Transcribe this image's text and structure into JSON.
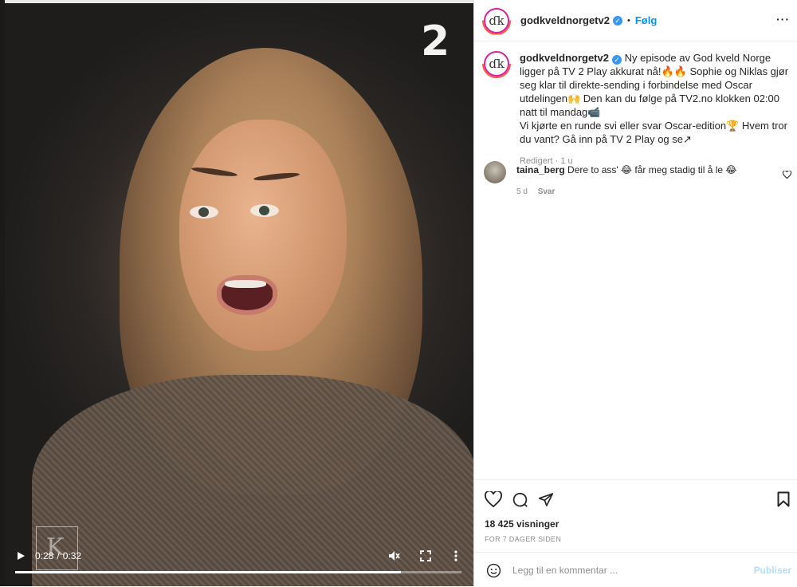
{
  "video": {
    "channel_logo": "2",
    "watermark": "K",
    "time_current": "0:28",
    "time_separator": "/",
    "time_total": "0:32",
    "progress": 0.865,
    "icons": {
      "play": "play-icon",
      "mute": "volume-muted-icon",
      "fullscreen": "fullscreen-icon",
      "more": "more-vertical-icon"
    }
  },
  "post": {
    "header": {
      "avatar_text": "ɗk",
      "username": "godkveldnorgetv2",
      "dot": "•",
      "follow_label": "Følg",
      "more_label": "···"
    },
    "caption": {
      "username": "godkveldnorgetv2",
      "text_lines": [
        "Ny episode av God kveld Norge ligger på TV 2 Play akkurat nå!🔥🔥 Sophie og Niklas gjør seg klar til direkte-sending i forbindelse med Oscar utdelingen🙌 Den kan du følge på TV2.no klokken 02:00 natt til mandag📹",
        "Vi kjørte en runde svi eller svar Oscar-edition🏆 Hvem tror du vant? Gå inn på TV 2 Play og se↗"
      ],
      "meta": "Redigert · 1 u"
    },
    "comments": [
      {
        "username": "taina_berg",
        "text": "Dere to ass' 😂 får meg stadig til å le 😂",
        "age": "5 d",
        "reply_label": "Svar"
      }
    ],
    "views": "18 425 visninger",
    "date": "FOR 7 DAGER SIDEN",
    "comment_box": {
      "placeholder": "Legg til en kommentar ...",
      "publish_label": "Publiser"
    },
    "colors": {
      "accent": "#0095f6",
      "verified": "#3897f0",
      "publish_disabled": "#b2dffc"
    }
  }
}
